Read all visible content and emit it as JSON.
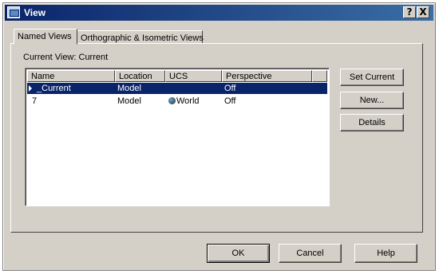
{
  "window": {
    "title": "View",
    "help_button": "?",
    "close_button": "X"
  },
  "tabs": [
    {
      "label": "Named Views",
      "active": true
    },
    {
      "label": "Orthographic & Isometric Views",
      "active": false
    }
  ],
  "current_view": {
    "label": "Current View:",
    "value": "Current"
  },
  "list": {
    "columns": [
      "Name",
      "Location",
      "UCS",
      "Perspective"
    ],
    "rows": [
      {
        "name": "Current",
        "location": "Model",
        "ucs": "",
        "perspective": "Off",
        "selected": true
      },
      {
        "name": "7",
        "location": "Model",
        "ucs": "World",
        "perspective": "Off",
        "selected": false
      }
    ]
  },
  "side_buttons": {
    "set_current": "Set Current",
    "new": "New...",
    "details": "Details"
  },
  "footer_buttons": {
    "ok": "OK",
    "cancel": "Cancel",
    "help": "Help"
  },
  "colors": {
    "face": "#d4d0c8",
    "title_start": "#0a246a",
    "title_end": "#3a6ea5",
    "selection": "#0a246a"
  },
  "icons": {
    "window": "view-window-icon",
    "row_marker": "triangle-right-icon",
    "ucs_world": "globe-icon"
  }
}
